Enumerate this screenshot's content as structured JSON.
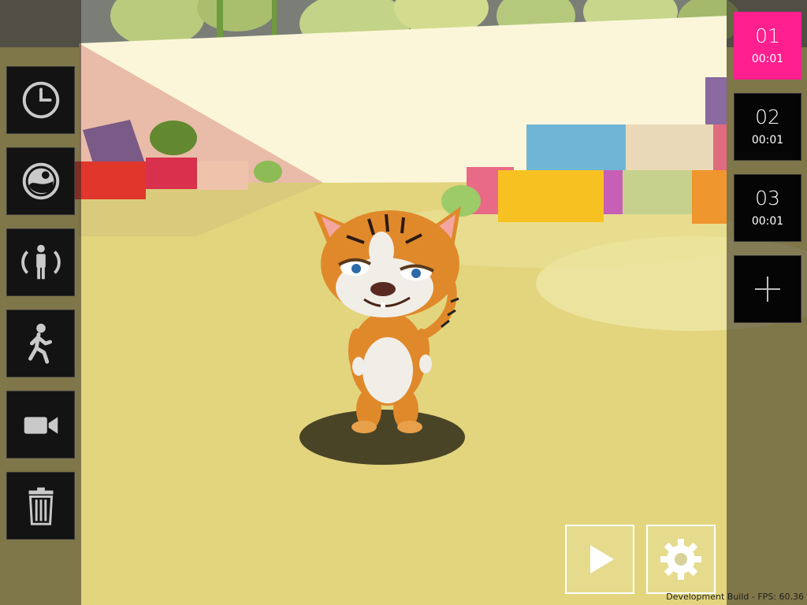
{
  "left_toolbar": {
    "buttons": [
      {
        "id": "clock",
        "icon": "clock-icon"
      },
      {
        "id": "filters",
        "icon": "globe-filter-icon"
      },
      {
        "id": "pose",
        "icon": "character-pose-icon"
      },
      {
        "id": "animation",
        "icon": "running-figure-icon"
      },
      {
        "id": "camera",
        "icon": "video-camera-icon"
      },
      {
        "id": "delete",
        "icon": "trash-icon"
      }
    ]
  },
  "clips": [
    {
      "number": "01",
      "time": "00:01",
      "active": true
    },
    {
      "number": "02",
      "time": "00:01",
      "active": false
    },
    {
      "number": "03",
      "time": "00:01",
      "active": false
    }
  ],
  "add_clip": {
    "icon": "plus-icon"
  },
  "controls": {
    "play_icon": "play-icon",
    "settings_icon": "gear-icon"
  },
  "status": {
    "fps_text": "Development Build - FPS: 60.36"
  },
  "colors": {
    "active_clip": "#ff1f8e",
    "panel": "#050505",
    "ground": "#e2d57e"
  }
}
